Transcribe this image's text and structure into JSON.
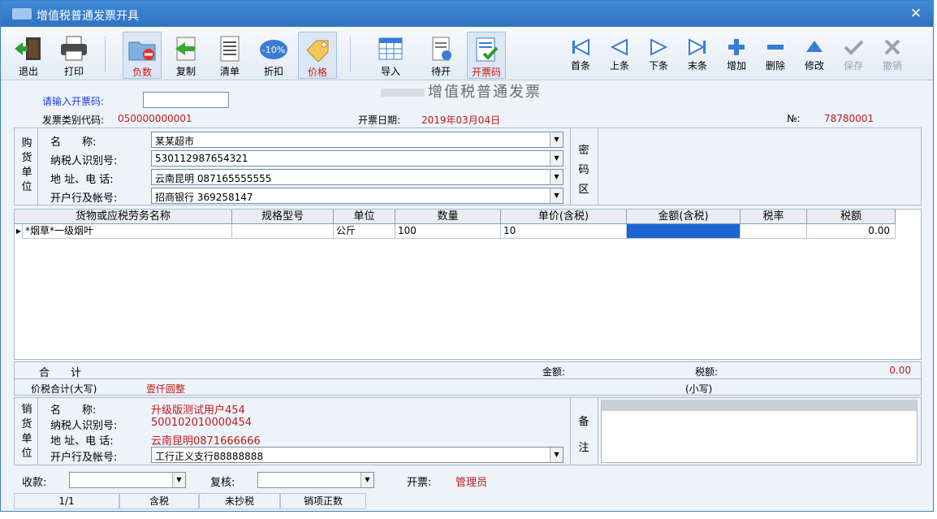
{
  "window": {
    "title": "增值税普通发票开具",
    "close_glyph": "✕"
  },
  "toolbar": {
    "exit": "退出",
    "print": "打印",
    "negative": "负数",
    "copy": "复制",
    "list": "清单",
    "discount": "折扣",
    "price": "价格",
    "import": "导入",
    "pending": "待开",
    "issue": "开票码",
    "first": "首条",
    "prev": "上条",
    "next": "下条",
    "last": "末条",
    "add": "增加",
    "delete": "删除",
    "edit": "修改",
    "save": "保存",
    "cancel": "撤销",
    "discount_badge": "-10%"
  },
  "header": {
    "doc_title": "增值税普通发票",
    "code_prompt": "请输入开票码:",
    "code_value": "",
    "type_code_label": "发票类别代码:",
    "type_code_value": "050000000001",
    "date_label": "开票日期:",
    "date_value": "2019年03月04日",
    "no_label": "№:",
    "no_value": "78780001"
  },
  "buyer": {
    "side_label": [
      "购",
      "货",
      "单",
      "位"
    ],
    "name_label": "名　　称:",
    "name_value": "某某超市",
    "tax_label": "纳税人识别号:",
    "tax_value": "530112987654321",
    "addr_label": "地 址、电 话:",
    "addr_value": "云南昆明 087165555555",
    "bank_label": "开户行及帐号:",
    "bank_value": "招商银行 369258147",
    "cipher_label": [
      "密",
      "码",
      "区"
    ]
  },
  "grid": {
    "columns": [
      "货物或应税劳务名称",
      "规格型号",
      "单位",
      "数量",
      "单价(含税)",
      "金额(含税)",
      "税率",
      "税额"
    ],
    "rows": [
      {
        "name": "*烟草*一级烟叶",
        "spec": "",
        "unit": "公斤",
        "qty": "100",
        "price": "10",
        "amount": "",
        "rate": "",
        "tax": "0.00"
      }
    ]
  },
  "totals": {
    "sum_label": "合　　计",
    "amount_label": "金额:",
    "tax_label": "税额:",
    "tax_value": "0.00",
    "grand_label": "价税合计(大写)",
    "grand_upper": "壹仟圆整",
    "small_label": "(小写)"
  },
  "seller": {
    "side_label": [
      "销",
      "货",
      "单",
      "位"
    ],
    "name_label": "名　　称:",
    "name_value": "升级版测试用户454",
    "tax_label": "纳税人识别号:",
    "tax_value": "500102010000454",
    "addr_label": "地 址、电 话:",
    "addr_value": "云南昆明0871666666",
    "bank_label": "开户行及帐号:",
    "bank_value": "工行正义支行88888888",
    "note_label": [
      "备",
      "注"
    ]
  },
  "footer": {
    "payee_label": "收款:",
    "reviewer_label": "复核:",
    "issuer_label": "开票:",
    "issuer_value": "管理员"
  },
  "status": [
    "1/1",
    "含税",
    "未抄税",
    "销项正数"
  ],
  "colors": {
    "title_bar": "#2f72c0",
    "accent_red": "#c01a1a",
    "prompt_blue": "#1a3fd6",
    "selection": "#1e64d2"
  }
}
